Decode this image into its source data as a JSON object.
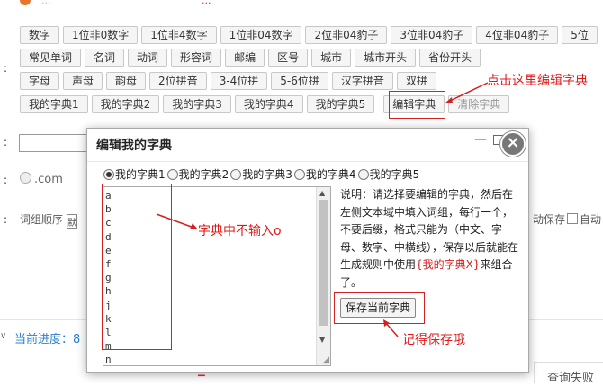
{
  "top": {
    "cut_text": "...",
    "cut_red": "..."
  },
  "row1": [
    "数字",
    "1位非0数字",
    "1位非4数字",
    "1位非04数字",
    "2位非04豹子",
    "3位非04豹子",
    "4位非04豹子",
    "5位"
  ],
  "row2": [
    "常见单词",
    "名词",
    "动词",
    "形容词",
    "邮编",
    "区号",
    "城市",
    "城市开头",
    "省份开头"
  ],
  "row3": [
    "字母",
    "声母",
    "韵母",
    "2位拼音",
    "3-4位拼",
    "5-6位拼",
    "汉字拼音",
    "双拼"
  ],
  "row4": [
    "我的字典1",
    "我的字典2",
    "我的字典3",
    "我的字典4",
    "我的字典5",
    "编辑字典",
    "清除字典"
  ],
  "colon": ":",
  "annotations": {
    "edit_dict": "点击这里编辑字典",
    "no_input": "字典中不输入o",
    "remember_save": "记得保存哦"
  },
  "background": {
    "dotcom": ".com",
    "word_order": "词组顺序",
    "word_order_sel": "默",
    "auto_save_tail": "动保存",
    "auto_tail": "自动",
    "progress_label": "当前进度：8",
    "query_fail_tab": "查询失败"
  },
  "dialog": {
    "title": "编辑我的字典",
    "min_symbol": "—",
    "close_symbol": "×",
    "radios": [
      {
        "label": "我的字典1",
        "checked": true
      },
      {
        "label": "我的字典2",
        "checked": false
      },
      {
        "label": "我的字典3",
        "checked": false
      },
      {
        "label": "我的字典4",
        "checked": false
      },
      {
        "label": "我的字典5",
        "checked": false
      }
    ],
    "textarea_lines": [
      "a",
      "b",
      "c",
      "d",
      "e",
      "f",
      "g",
      "h",
      "j",
      "k",
      "l",
      "m",
      "n"
    ],
    "help_pre": "说明：请选择要编辑的字典，然后在左侧文本域中填入词组，每行一个，不要后缀，格式只能为（中文、字母、数字、中横线），保存以后就能在生成规则中使用",
    "help_red": "{我的字典X}",
    "help_post": "来组合了。",
    "save_button": "保存当前字典"
  },
  "colors": {
    "annotation_red": "#e01818",
    "progress_blue": "#2a7fcf"
  }
}
